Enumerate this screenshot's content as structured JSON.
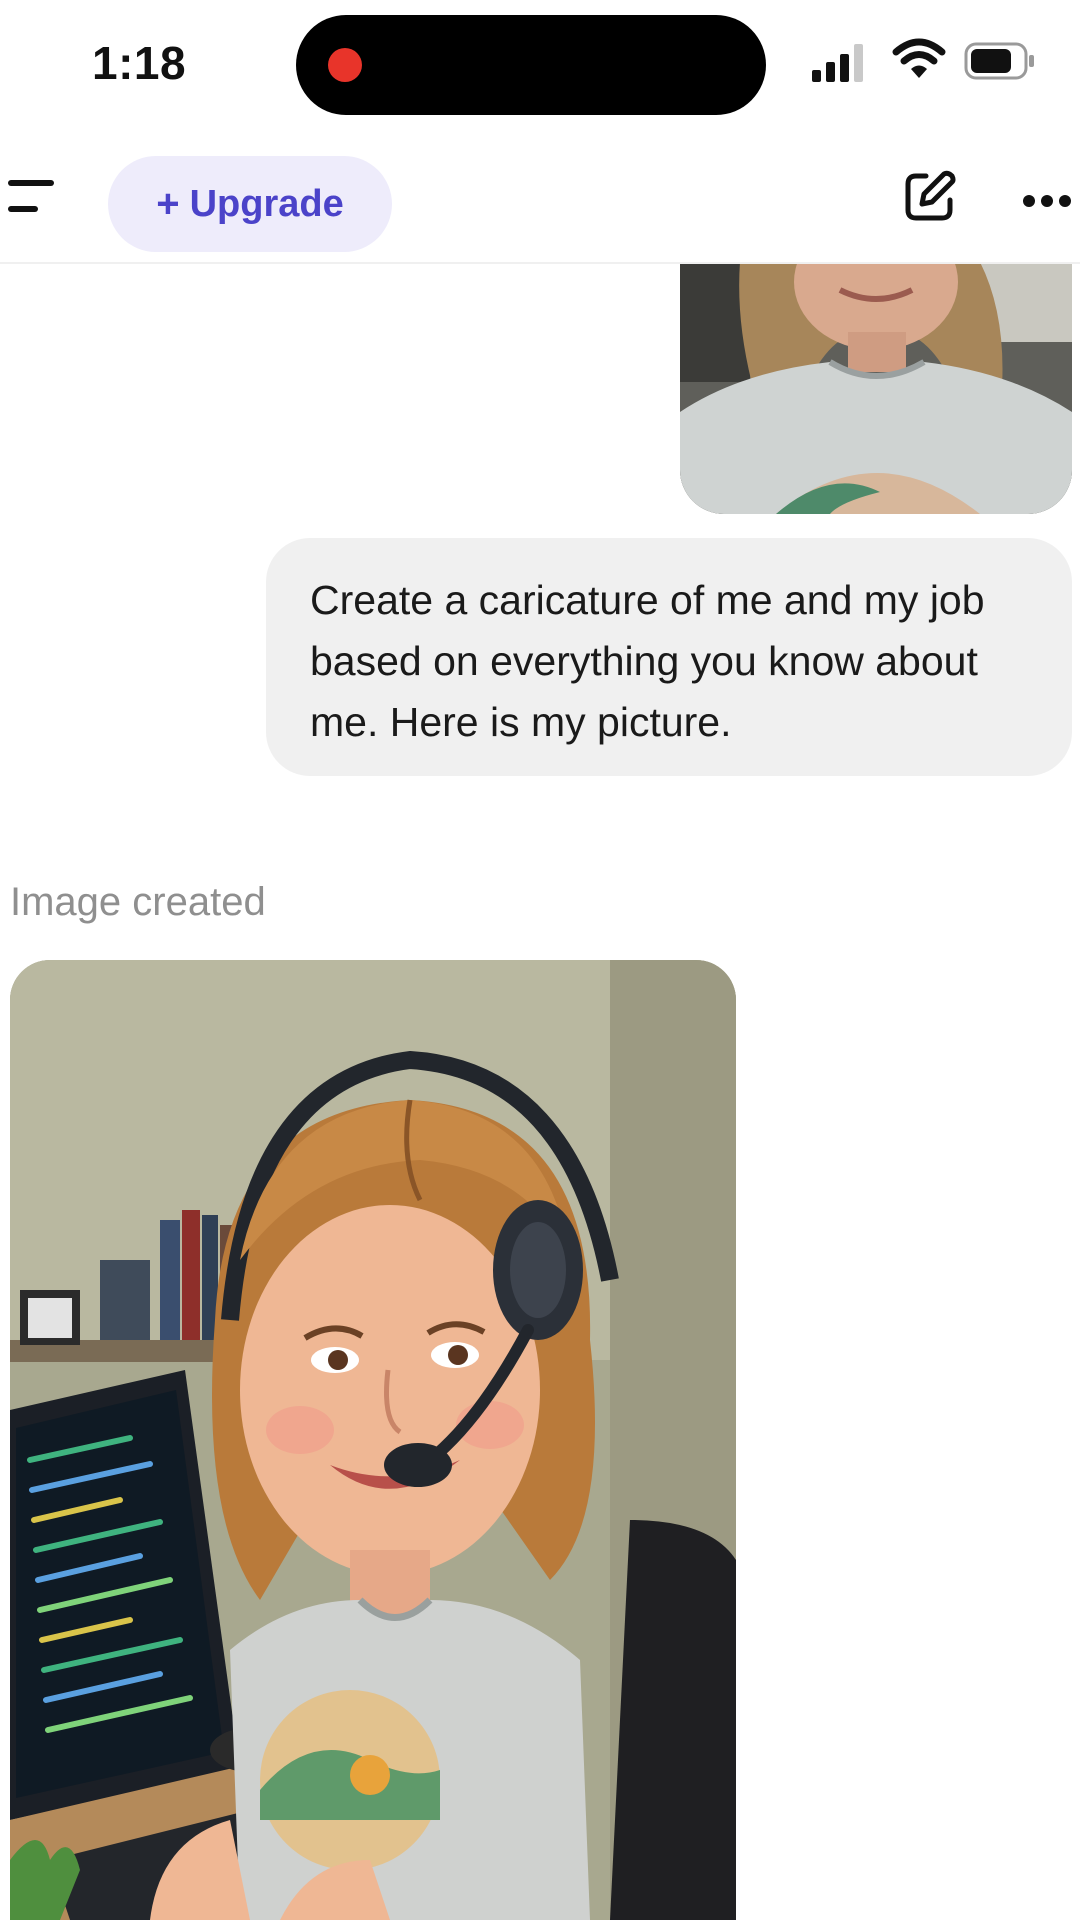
{
  "status_bar": {
    "time": "1:18",
    "recording_indicator_color": "#e8342a",
    "icons": [
      "signal-icon",
      "wifi-icon",
      "battery-icon"
    ]
  },
  "nav": {
    "upgrade_label": "Upgrade",
    "upgrade_icon": "plus-icon",
    "icons": [
      "menu-icon",
      "edit-icon",
      "more-icon"
    ],
    "accent_color": "#4b43c9"
  },
  "chat": {
    "user_message": "Create a caricature of me and my job based on everything you know about me. Here is my picture.",
    "image_status": "Image created"
  }
}
